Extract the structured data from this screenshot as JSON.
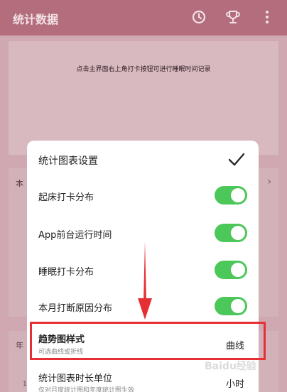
{
  "app": {
    "title": "统计数据",
    "header_icons": [
      "clock-icon",
      "trophy-icon",
      "more-vert-icon"
    ],
    "hint": "点击主界面右上角打卡按钮可进行睡眠时间记录",
    "card2_label": "本",
    "card3_label": "年",
    "card3_tick": "1"
  },
  "dialog": {
    "title": "统计图表设置",
    "confirm_icon": "check-icon",
    "toggles": [
      {
        "label": "起床打卡分布",
        "on": true
      },
      {
        "label": "App前台运行时间",
        "on": true
      },
      {
        "label": "睡眠打卡分布",
        "on": true
      },
      {
        "label": "本月打断原因分布",
        "on": true
      }
    ],
    "trend": {
      "title": "趋势图样式",
      "subtitle": "可选曲线或折线",
      "value": "曲线"
    },
    "unit": {
      "title": "统计图表时长单位",
      "subtitle": "仅对月度统计图和年度统计图生效",
      "value": "小时"
    }
  },
  "colors": {
    "header": "#b36d7d",
    "toggle_on": "#4cc75a",
    "annotation": "#e53033"
  },
  "watermark": "Baidu经验"
}
